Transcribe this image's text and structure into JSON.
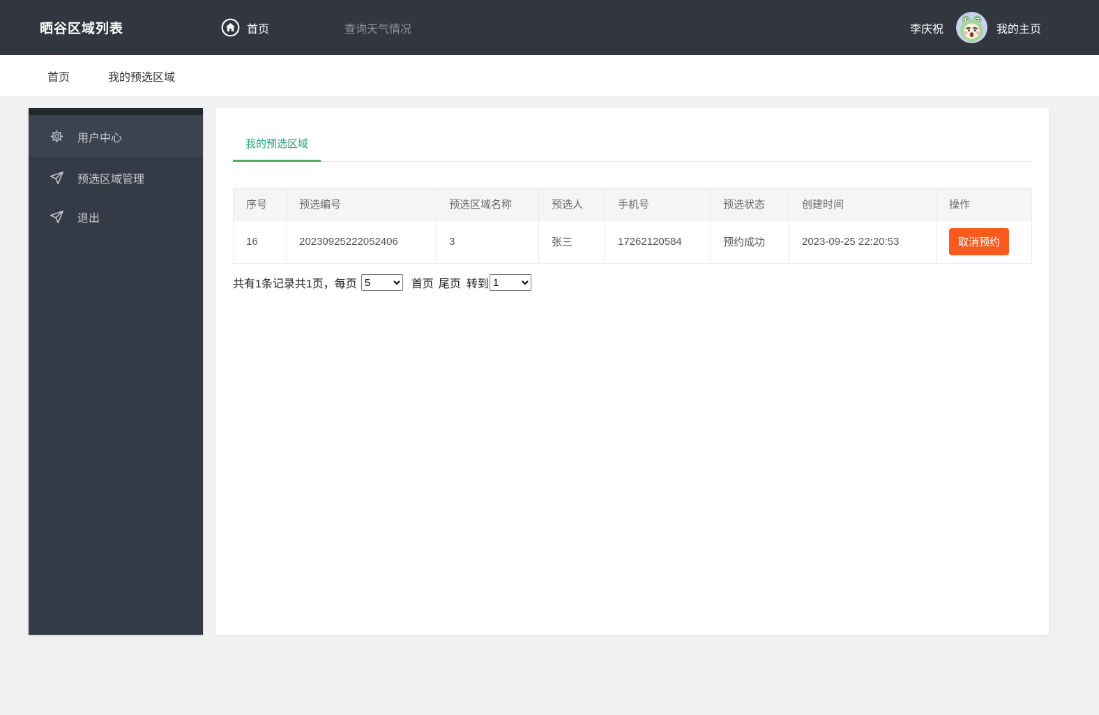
{
  "navbar": {
    "title": "晒谷区域列表",
    "home_label": "首页",
    "weather_label": "查询天气情况",
    "username": "李庆祝",
    "profile_label": "我的主页"
  },
  "breadcrumb": {
    "items": [
      {
        "label": "首页"
      },
      {
        "label": "我的预选区域"
      }
    ]
  },
  "sidebar": {
    "items": [
      {
        "label": "用户中心",
        "icon": "gear-icon"
      },
      {
        "label": "预选区域管理",
        "icon": "send-icon"
      },
      {
        "label": "退出",
        "icon": "send-icon"
      }
    ]
  },
  "main": {
    "tab": "我的预选区域",
    "table": {
      "headers": [
        "序号",
        "预选编号",
        "预选区域名称",
        "预选人",
        "手机号",
        "预选状态",
        "创建时间",
        "操作"
      ],
      "rows": [
        {
          "seq": "16",
          "code": "20230925222052406",
          "area": "3",
          "person": "张三",
          "phone": "17262120584",
          "status": "预约成功",
          "created": "2023-09-25 22:20:53",
          "action": "取消预约"
        }
      ]
    },
    "pagination": {
      "summary": "共有1条记录共1页，每页",
      "page_size": "5",
      "first_label": "首页",
      "last_label": "尾页",
      "goto_label": "转到",
      "current_page": "1"
    }
  },
  "colors": {
    "navbar_bg": "#32363e",
    "sidebar_bg": "#343a46",
    "tab_green": "#26a17b",
    "status_green": "#21a13c",
    "button_orange": "#fa5a1e",
    "page_bg": "#f1f1f2"
  }
}
